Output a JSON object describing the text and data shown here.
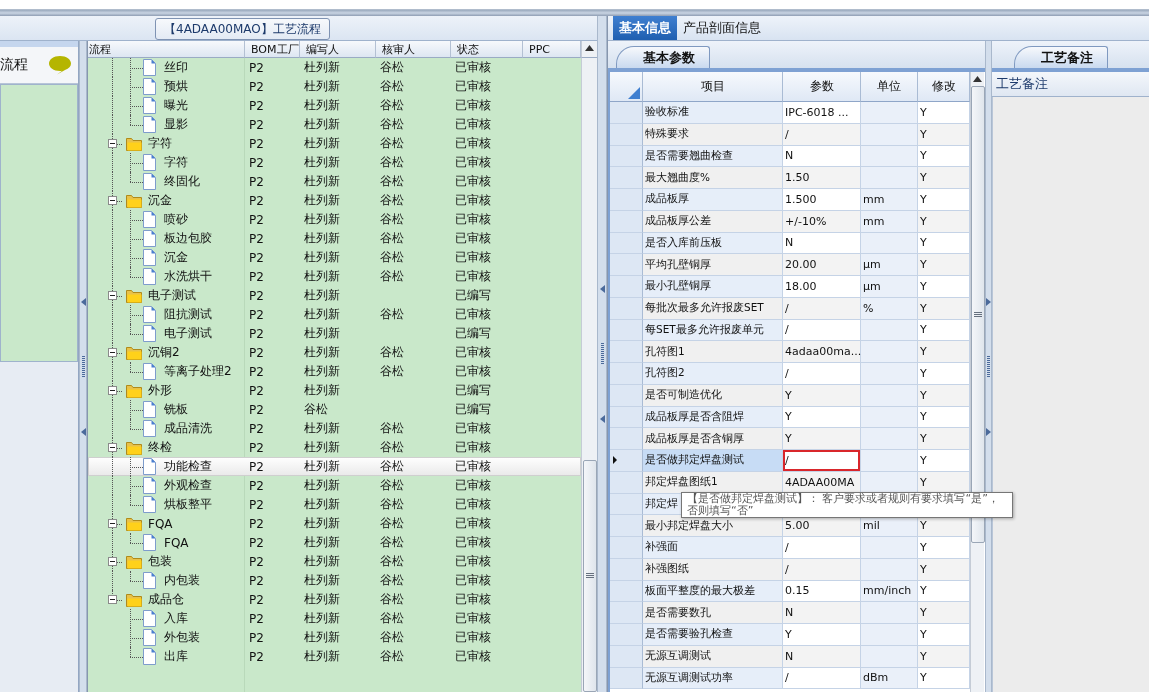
{
  "sidebar": {
    "items": [
      {
        "label": "流程"
      }
    ]
  },
  "tree": {
    "title": "【4ADAA00MAO】工艺流程",
    "columns": [
      "流程",
      "BOM工厂",
      "编写人",
      "核审人",
      "状态",
      "PPC"
    ],
    "groups": [
      {
        "children": [
          {
            "label": "丝印",
            "bom": "P2",
            "author": "杜列新",
            "reviewer": "谷松",
            "status": "已审核",
            "selected": false
          },
          {
            "label": "预烘",
            "bom": "P2",
            "author": "杜列新",
            "reviewer": "谷松",
            "status": "已审核",
            "selected": false
          },
          {
            "label": "曝光",
            "bom": "P2",
            "author": "杜列新",
            "reviewer": "谷松",
            "status": "已审核",
            "selected": false
          },
          {
            "label": "显影",
            "bom": "P2",
            "author": "杜列新",
            "reviewer": "谷松",
            "status": "已审核",
            "selected": false
          }
        ]
      },
      {
        "label": "字符",
        "bom": "P2",
        "author": "杜列新",
        "reviewer": "谷松",
        "status": "已审核",
        "expanded": true,
        "selected": false,
        "children": [
          {
            "label": "字符",
            "bom": "P2",
            "author": "杜列新",
            "reviewer": "谷松",
            "status": "已审核",
            "selected": false
          },
          {
            "label": "终固化",
            "bom": "P2",
            "author": "杜列新",
            "reviewer": "谷松",
            "status": "已审核",
            "selected": false
          }
        ]
      },
      {
        "label": "沉金",
        "bom": "P2",
        "author": "杜列新",
        "reviewer": "谷松",
        "status": "已审核",
        "expanded": true,
        "selected": false,
        "children": [
          {
            "label": "喷砂",
            "bom": "P2",
            "author": "杜列新",
            "reviewer": "谷松",
            "status": "已审核",
            "selected": false
          },
          {
            "label": "板边包胶",
            "bom": "P2",
            "author": "杜列新",
            "reviewer": "谷松",
            "status": "已审核",
            "selected": false
          },
          {
            "label": "沉金",
            "bom": "P2",
            "author": "杜列新",
            "reviewer": "谷松",
            "status": "已审核",
            "selected": false
          },
          {
            "label": "水洗烘干",
            "bom": "P2",
            "author": "杜列新",
            "reviewer": "谷松",
            "status": "已审核",
            "selected": false
          }
        ]
      },
      {
        "label": "电子测试",
        "bom": "P2",
        "author": "杜列新",
        "status": "已编写",
        "expanded": true,
        "selected": false,
        "children": [
          {
            "label": "阻抗测试",
            "bom": "P2",
            "author": "杜列新",
            "reviewer": "谷松",
            "status": "已审核",
            "selected": false
          },
          {
            "label": "电子测试",
            "bom": "P2",
            "author": "杜列新",
            "status": "已编写",
            "selected": false
          }
        ]
      },
      {
        "label": "沉铜2",
        "bom": "P2",
        "author": "杜列新",
        "reviewer": "谷松",
        "status": "已审核",
        "expanded": true,
        "selected": false,
        "children": [
          {
            "label": "等离子处理2",
            "bom": "P2",
            "author": "杜列新",
            "reviewer": "谷松",
            "status": "已审核",
            "selected": false
          }
        ]
      },
      {
        "label": "外形",
        "bom": "P2",
        "author": "杜列新",
        "status": "已编写",
        "expanded": true,
        "selected": false,
        "children": [
          {
            "label": "铣板",
            "bom": "P2",
            "author": "谷松",
            "status": "已编写",
            "selected": false
          },
          {
            "label": "成品清洗",
            "bom": "P2",
            "author": "杜列新",
            "reviewer": "谷松",
            "status": "已审核",
            "selected": false
          }
        ]
      },
      {
        "label": "终检",
        "bom": "P2",
        "author": "杜列新",
        "reviewer": "谷松",
        "status": "已审核",
        "expanded": true,
        "selected": false,
        "children": [
          {
            "label": "功能检查",
            "bom": "P2",
            "author": "杜列新",
            "reviewer": "谷松",
            "status": "已审核",
            "selected": true
          },
          {
            "label": "外观检查",
            "bom": "P2",
            "author": "杜列新",
            "reviewer": "谷松",
            "status": "已审核",
            "selected": false
          },
          {
            "label": "烘板整平",
            "bom": "P2",
            "author": "杜列新",
            "reviewer": "谷松",
            "status": "已审核",
            "selected": false
          }
        ]
      },
      {
        "label": "FQA",
        "bom": "P2",
        "author": "杜列新",
        "reviewer": "谷松",
        "status": "已审核",
        "expanded": true,
        "selected": false,
        "children": [
          {
            "label": "FQA",
            "bom": "P2",
            "author": "杜列新",
            "reviewer": "谷松",
            "status": "已审核",
            "selected": false
          }
        ]
      },
      {
        "label": "包装",
        "bom": "P2",
        "author": "杜列新",
        "reviewer": "谷松",
        "status": "已审核",
        "expanded": true,
        "selected": false,
        "children": [
          {
            "label": "内包装",
            "bom": "P2",
            "author": "杜列新",
            "reviewer": "谷松",
            "status": "已审核",
            "selected": false
          }
        ]
      },
      {
        "label": "成品仓",
        "bom": "P2",
        "author": "杜列新",
        "reviewer": "谷松",
        "status": "已审核",
        "expanded": true,
        "selected": false,
        "children": [
          {
            "label": "入库",
            "bom": "P2",
            "author": "杜列新",
            "reviewer": "谷松",
            "status": "已审核",
            "selected": false
          },
          {
            "label": "外包装",
            "bom": "P2",
            "author": "杜列新",
            "reviewer": "谷松",
            "status": "已审核",
            "selected": false
          },
          {
            "label": "出库",
            "bom": "P2",
            "author": "杜列新",
            "reviewer": "谷松",
            "status": "已审核",
            "selected": false
          }
        ]
      }
    ]
  },
  "tabs": [
    {
      "label": "基本信息",
      "selected": true
    },
    {
      "label": "产品剖面信息",
      "selected": false
    }
  ],
  "params": {
    "tab": "基本参数",
    "columns": [
      "项目",
      "参数",
      "单位",
      "修改"
    ],
    "rows": [
      {
        "item": "验收标准",
        "param": "IPC-6018 ...",
        "modify": "Y",
        "selected": false,
        "highlighted": false
      },
      {
        "item": "特殊要求",
        "param": "/",
        "modify": "Y",
        "selected": false,
        "highlighted": false
      },
      {
        "item": "是否需要翘曲检查",
        "param": "N",
        "modify": "Y",
        "selected": false,
        "highlighted": false
      },
      {
        "item": "最大翘曲度%",
        "param": "1.50",
        "modify": "Y",
        "selected": false,
        "highlighted": false
      },
      {
        "item": "成品板厚",
        "param": "1.500",
        "unit": "mm",
        "modify": "Y",
        "selected": false,
        "highlighted": false
      },
      {
        "item": "成品板厚公差",
        "param": "+/-10%",
        "unit": "mm",
        "modify": "Y",
        "selected": false,
        "highlighted": false
      },
      {
        "item": "是否入库前压板",
        "param": "N",
        "modify": "Y",
        "selected": false,
        "highlighted": false
      },
      {
        "item": "平均孔壁铜厚",
        "param": "20.00",
        "unit": "μm",
        "modify": "Y",
        "selected": false,
        "highlighted": false
      },
      {
        "item": "最小孔壁铜厚",
        "param": "18.00",
        "unit": "μm",
        "modify": "Y",
        "selected": false,
        "highlighted": false
      },
      {
        "item": "每批次最多允许报废SET",
        "param": "/",
        "unit": "%",
        "modify": "Y",
        "selected": false,
        "highlighted": false
      },
      {
        "item": "每SET最多允许报废单元",
        "param": "/",
        "modify": "Y",
        "selected": false,
        "highlighted": false
      },
      {
        "item": "孔符图1",
        "param": "4adaa00ma...",
        "modify": "Y",
        "selected": false,
        "highlighted": false
      },
      {
        "item": "孔符图2",
        "param": "/",
        "modify": "Y",
        "selected": false,
        "highlighted": false
      },
      {
        "item": "是否可制造优化",
        "param": "Y",
        "modify": "Y",
        "selected": false,
        "highlighted": false
      },
      {
        "item": "成品板厚是否含阻焊",
        "param": "Y",
        "modify": "Y",
        "selected": false,
        "highlighted": false
      },
      {
        "item": "成品板厚是否含铜厚",
        "param": "Y",
        "modify": "Y",
        "selected": false,
        "highlighted": false
      },
      {
        "item": "是否做邦定焊盘测试",
        "param": "/",
        "modify": "Y",
        "selected": true,
        "highlighted": true
      },
      {
        "item": "邦定焊盘图纸1",
        "param": "4ADAA00MA",
        "modify": "Y",
        "selected": false,
        "highlighted": false
      },
      {
        "item": "邦定焊",
        "selected": false
      },
      {
        "item": "最小邦定焊盘大小",
        "param": "5.00",
        "unit": "mil",
        "modify": "Y",
        "selected": false,
        "highlighted": false
      },
      {
        "item": "补强面",
        "param": "/",
        "modify": "Y",
        "selected": false,
        "highlighted": false
      },
      {
        "item": "补强图纸",
        "param": "/",
        "modify": "Y",
        "selected": false,
        "highlighted": false
      },
      {
        "item": "板面平整度的最大极差",
        "param": "0.15",
        "unit": "mm/inch",
        "modify": "Y",
        "selected": false,
        "highlighted": false
      },
      {
        "item": "是否需要数孔",
        "param": "N",
        "modify": "Y",
        "selected": false,
        "highlighted": false
      },
      {
        "item": "是否需要验孔检查",
        "param": "Y",
        "modify": "Y",
        "selected": false,
        "highlighted": false
      },
      {
        "item": "无源互调测试",
        "param": "N",
        "modify": "Y",
        "selected": false,
        "highlighted": false
      },
      {
        "item": "无源互调测试功率",
        "param": "/",
        "unit": "dBm",
        "modify": "Y",
        "selected": false,
        "highlighted": false
      }
    ],
    "tooltip": "【是否做邦定焊盘测试】： 客户要求或者规则有要求填写“是”，否则填写“否”"
  },
  "remarks": {
    "tab": "工艺备注",
    "header": "工艺备注"
  }
}
